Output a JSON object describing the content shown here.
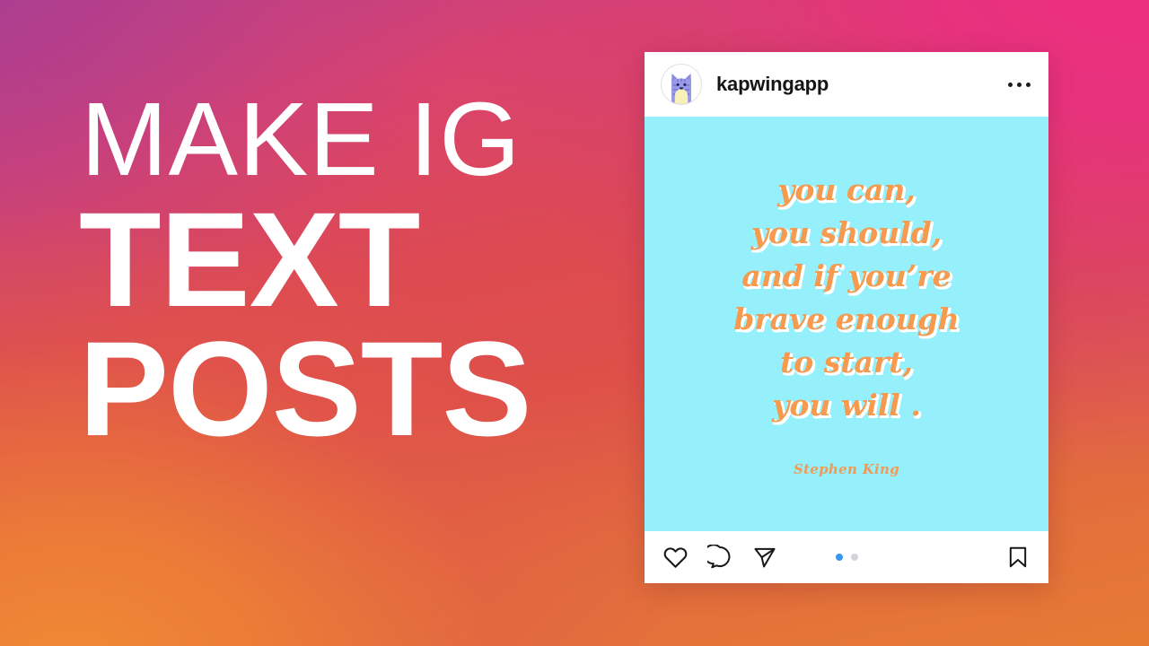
{
  "background": {
    "gradient_colors": {
      "top_left_purple": "#b43f8a",
      "top_right_pink": "#e73280",
      "mid_left_red": "#dd4e4a",
      "bottom_right_red": "#e0484c",
      "bottom_left_orange": "#e57735"
    }
  },
  "headline": {
    "line1": "MAKE IG",
    "line2": "TEXT",
    "line3": "POSTS",
    "color": "#ffffff"
  },
  "post": {
    "username": "kapwingapp",
    "avatar_icon": "cat-avatar-icon",
    "more_menu_icon": "more-options-icon",
    "image": {
      "background_color": "#96f0fb",
      "text_color": "#f59a4e",
      "shadow_color": "#ffffff",
      "quote_lines": [
        "you can,",
        "you should,",
        "and if you’re",
        "brave enough",
        "to start,",
        "you will ."
      ],
      "author": "Stephen King"
    },
    "actions": {
      "like_icon": "heart-icon",
      "comment_icon": "comment-icon",
      "share_icon": "share-paper-plane-icon",
      "save_icon": "bookmark-icon",
      "carousel": {
        "count": 2,
        "active_index": 0,
        "active_color": "#3897f0",
        "inactive_color": "#d2d5da"
      }
    }
  }
}
